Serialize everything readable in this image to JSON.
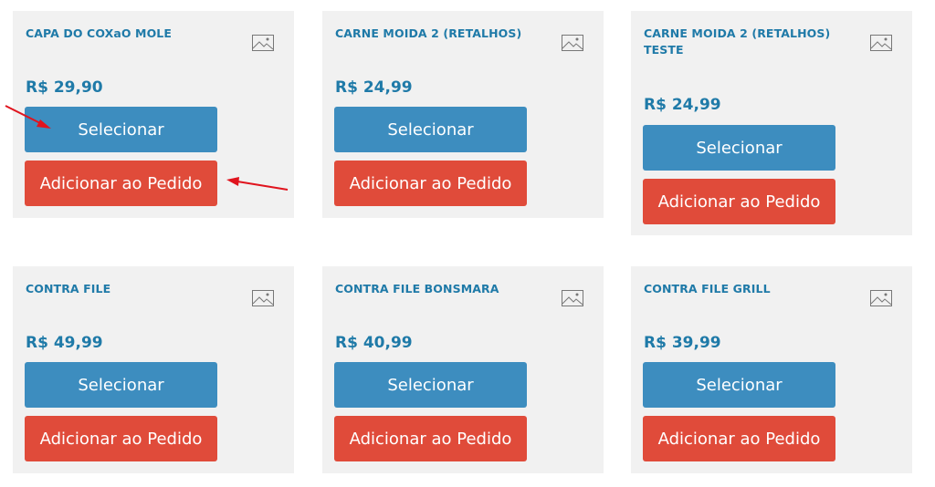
{
  "colors": {
    "card_bg": "#f1f1f1",
    "accent_text": "#1f7aa8",
    "select_button": "#3d8dbf",
    "add_button": "#e04b3a",
    "annotation_arrow": "#e0141e"
  },
  "products": [
    {
      "name": "CAPA DO COXaO MOLE",
      "price": "R$ 29,90",
      "select_label": "Selecionar",
      "add_label": "Adicionar ao Pedido",
      "image_icon": "image-placeholder-icon"
    },
    {
      "name": "CARNE MOIDA 2 (RETALHOS)",
      "price": "R$ 24,99",
      "select_label": "Selecionar",
      "add_label": "Adicionar ao Pedido",
      "image_icon": "image-placeholder-icon"
    },
    {
      "name": "CARNE MOIDA 2 (RETALHOS) TESTE",
      "price": "R$ 24,99",
      "select_label": "Selecionar",
      "add_label": "Adicionar ao Pedido",
      "image_icon": "image-placeholder-icon"
    },
    {
      "name": "CONTRA FILE",
      "price": "R$ 49,99",
      "select_label": "Selecionar",
      "add_label": "Adicionar ao Pedido",
      "image_icon": "image-placeholder-icon"
    },
    {
      "name": "CONTRA FILE BONSMARA",
      "price": "R$ 40,99",
      "select_label": "Selecionar",
      "add_label": "Adicionar ao Pedido",
      "image_icon": "image-placeholder-icon"
    },
    {
      "name": "CONTRA FILE GRILL",
      "price": "R$ 39,99",
      "select_label": "Selecionar",
      "add_label": "Adicionar ao Pedido",
      "image_icon": "image-placeholder-icon"
    }
  ]
}
